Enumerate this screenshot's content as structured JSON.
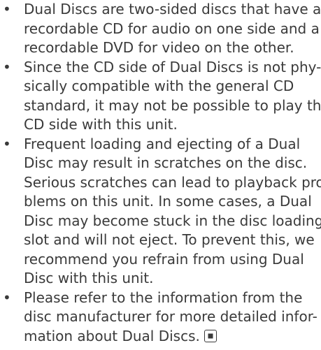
{
  "bullet_symbol": "•",
  "bullets": [
    {
      "lines": [
        "Dual Discs are two-sided discs that have a",
        "recordable CD for audio on one side and a",
        "recordable DVD for video on the other."
      ]
    },
    {
      "lines": [
        "Since the CD side of Dual Discs is not phy-",
        "sically compatible with the general CD",
        "standard, it may not be possible to play the",
        "CD side with this unit."
      ]
    },
    {
      "lines": [
        "Frequent loading and ejecting of a Dual",
        "Disc may result in scratches on the disc.",
        "Serious scratches can lead to playback pro-",
        "blems on this unit. In some cases, a Dual",
        "Disc may become stuck in the disc loading",
        "slot and will not eject. To prevent this, we",
        "recommend you refrain from using Dual",
        "Disc with this unit."
      ]
    },
    {
      "lines": [
        "Please refer to the information from the",
        "disc manufacturer for more detailed infor-",
        "mation about Dual Discs."
      ]
    }
  ],
  "end_mark_icon": "end-of-section-icon",
  "text_color": "#3a3a3a"
}
